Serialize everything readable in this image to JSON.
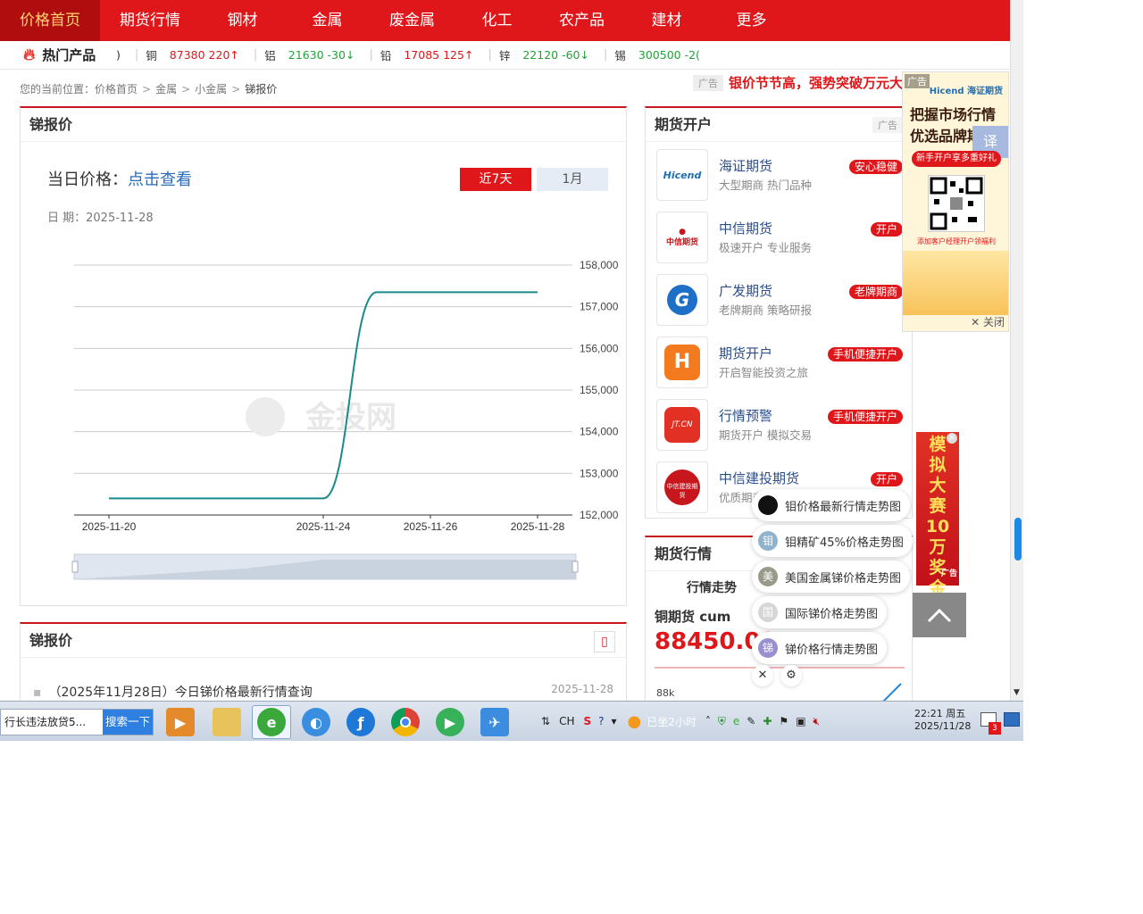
{
  "nav": {
    "items": [
      "价格首页",
      "期货行情",
      "钢材",
      "金属",
      "废金属",
      "化工",
      "农产品",
      "建材",
      "更多"
    ]
  },
  "ticker": {
    "label": "热门产品",
    "lead": ")",
    "items": [
      {
        "name": "铜",
        "price": "87380",
        "change": "220↑",
        "dir": "up"
      },
      {
        "name": "铝",
        "price": "21630",
        "change": "-30↓",
        "dir": "down"
      },
      {
        "name": "铅",
        "price": "17085",
        "change": "125↑",
        "dir": "up"
      },
      {
        "name": "锌",
        "price": "22120",
        "change": "-60↓",
        "dir": "down"
      },
      {
        "name": "锡",
        "price": "300500",
        "change": "-2(",
        "dir": "down"
      }
    ]
  },
  "breadcrumb": {
    "prefix": "您的当前位置：",
    "items": [
      "价格首页",
      "金属",
      "小金属"
    ],
    "current": "锑报价"
  },
  "top_ad": {
    "tag": "广告",
    "text": "银价节节高，强势突破万元大关"
  },
  "price_panel": {
    "title": "锑报价",
    "today_label": "当日价格：",
    "today_link": "点击查看",
    "date_label": "日 期：",
    "date_value": "2025-11-28",
    "range_tabs": [
      "近7天",
      "1月"
    ],
    "watermark": "金投网"
  },
  "chart_data": {
    "type": "line",
    "x": [
      "2025-11-20",
      "2025-11-24",
      "2025-11-25",
      "2025-11-26",
      "2025-11-27",
      "2025-11-28"
    ],
    "xticks": [
      "2025-11-20",
      "2025-11-24",
      "2025-11-26",
      "2025-11-28"
    ],
    "series": [
      {
        "values": [
          152400,
          152400,
          157350,
          157350,
          157350,
          157350
        ]
      }
    ],
    "yticks": [
      "158,000",
      "157,000",
      "156,000",
      "155,000",
      "154,000",
      "153,000",
      "152,000"
    ],
    "ylim": [
      152000,
      158000
    ],
    "grid": true,
    "line_color": "#1a8a8a"
  },
  "news_panel": {
    "title": "锑报价",
    "items": [
      {
        "title": "（2025年11月28日）今日锑价格最新行情查询",
        "date": "2025-11-28"
      }
    ]
  },
  "futures_panel": {
    "title": "期货开户",
    "ad_tag": "广告",
    "items": [
      {
        "name": "海证期货",
        "sub": "大型期商 热门品种",
        "badge": "安心稳健",
        "logo": "Hicend"
      },
      {
        "name": "中信期货",
        "sub": "极速开户 专业服务",
        "badge": "开户",
        "logo": "中信期货"
      },
      {
        "name": "广发期货",
        "sub": "老牌期商 策略研报",
        "badge": "老牌期商",
        "logo": "G"
      },
      {
        "name": "期货开户",
        "sub": "开启智能投资之旅",
        "badge": "手机便捷开户",
        "logo": "H"
      },
      {
        "name": "行情预警",
        "sub": "期货开户 模拟交易",
        "badge": "手机便捷开户",
        "logo": "JT.CN"
      },
      {
        "name": "中信建投期货",
        "sub": "优质期商",
        "badge": "开户",
        "logo": "中信建投期货"
      }
    ]
  },
  "quote_panel": {
    "title": "期货行情",
    "tab": "行情走势",
    "contract": "铜期货  cum",
    "value": "88450.00",
    "axis_label": "88k"
  },
  "side_ad": {
    "tag": "广告",
    "brand": "Hicend 海证期货",
    "headline_1": "把握市场行情",
    "headline_2": "优选品牌期货",
    "pill": "新手开户享多重好礼",
    "note": "添加客户经理开户领福利",
    "close": "关闭",
    "translate": "译"
  },
  "contest_ad": {
    "text": [
      "模",
      "拟",
      "大",
      "赛",
      "10",
      "万",
      "奖",
      "金"
    ],
    "tag": "广告"
  },
  "related_menu": {
    "items": [
      {
        "text": "钼价格最新行情走势图",
        "icon": "",
        "color": "#111111"
      },
      {
        "text": "钼精矿45%价格走势图",
        "icon": "钼",
        "color": "#8fb2cf"
      },
      {
        "text": "美国金属锑价格走势图",
        "icon": "美",
        "color": "#9a9a8a"
      },
      {
        "text": "国际锑价格走势图",
        "icon": "国",
        "color": "#d6d6d6"
      },
      {
        "text": "锑价格行情走势图",
        "icon": "锑",
        "color": "#9a8fd0"
      }
    ]
  },
  "taskbar": {
    "search_text": "行长违法放贷5...",
    "search_button": "搜索一下",
    "ime": "CH",
    "weather": "已坐2小时",
    "time": "22:21  周五",
    "date": "2025/11/28",
    "notify_count": "3"
  }
}
